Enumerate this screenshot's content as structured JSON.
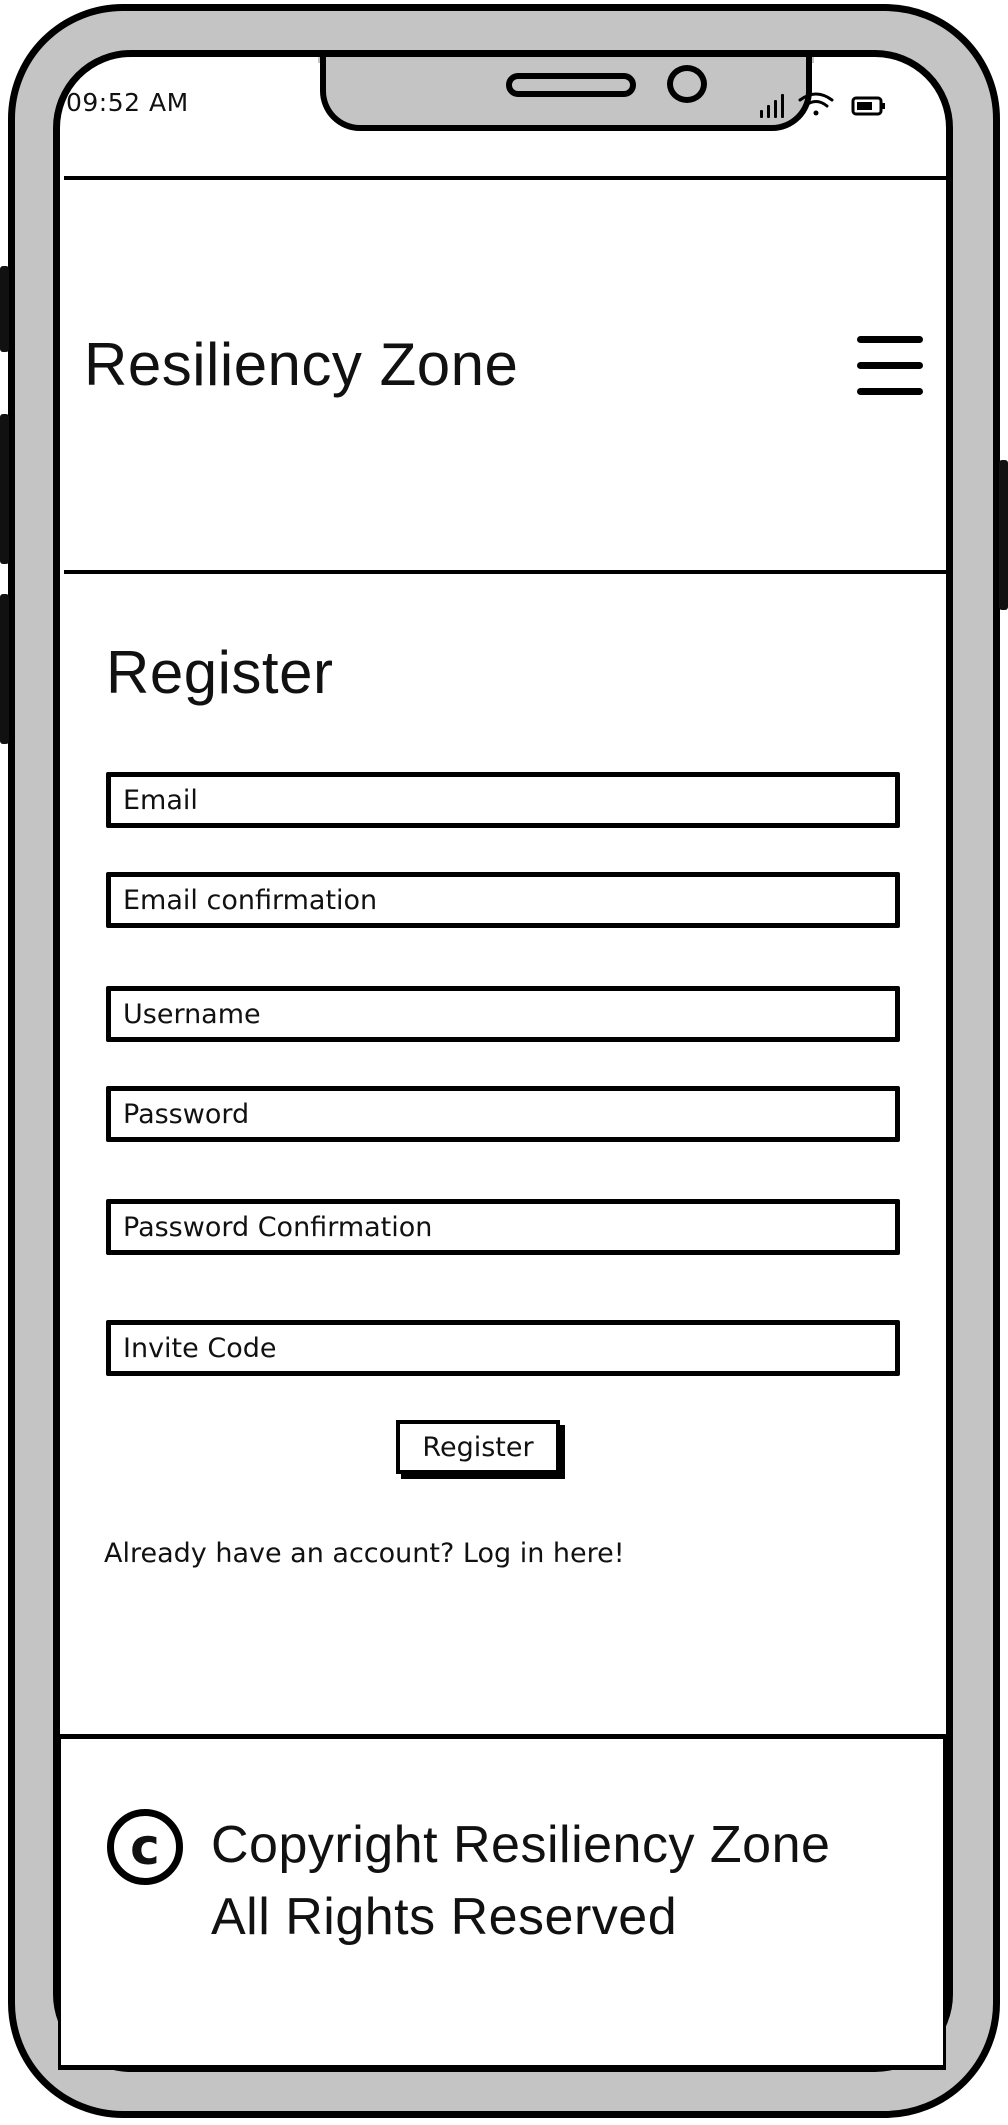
{
  "status_bar": {
    "time": "09:52 AM",
    "icons": [
      "signal-icon",
      "wifi-icon",
      "battery-icon"
    ]
  },
  "header": {
    "site_title": "Resiliency Zone",
    "menu_icon": "hamburger-menu-icon"
  },
  "register_form": {
    "title": "Register",
    "fields": {
      "email": "Email",
      "email_confirmation": "Email confirmation",
      "username": "Username",
      "password": "Password",
      "password_confirmation": "Password Confirmation",
      "invite_code": "Invite Code"
    },
    "submit_label": "Register",
    "login_prompt": "Already have an account? Log in here!"
  },
  "footer": {
    "icon": "copyright-icon",
    "symbol": "c",
    "line1": "Copyright Resiliency Zone",
    "line2": "All Rights Reserved"
  }
}
